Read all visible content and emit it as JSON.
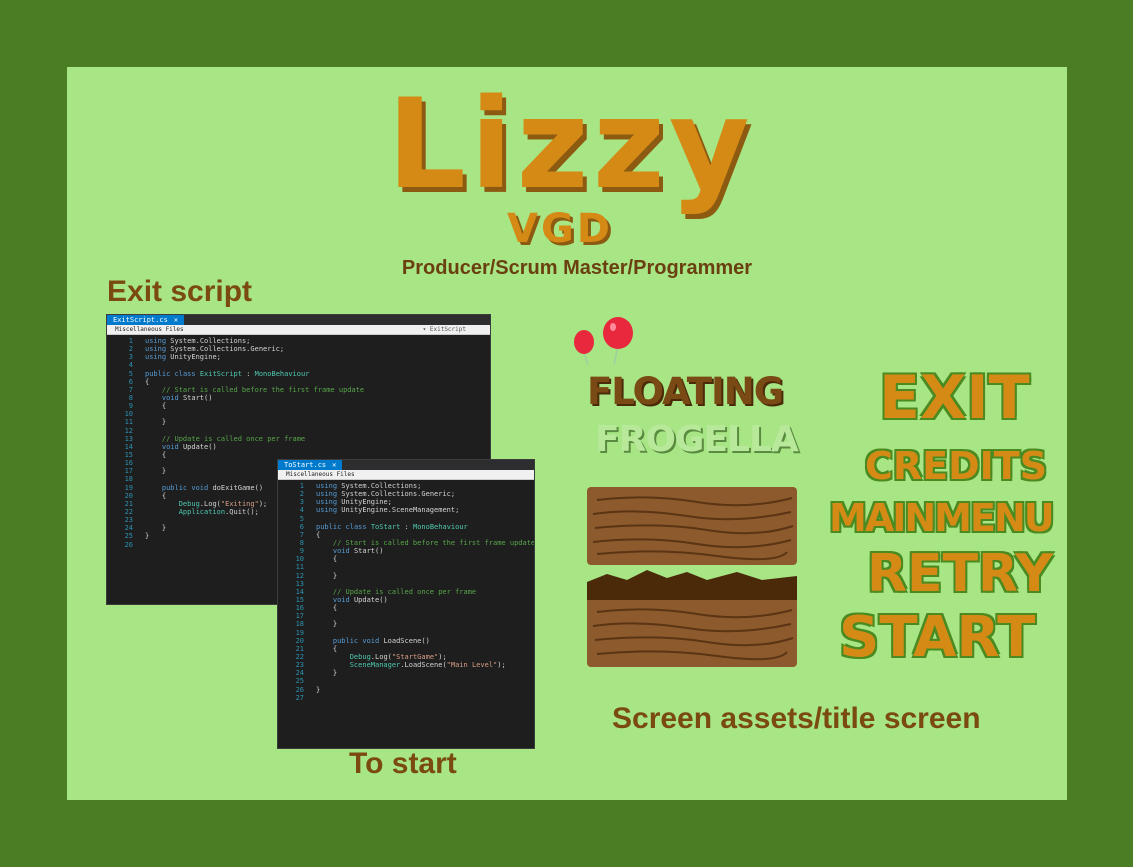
{
  "header": {
    "title": "Lizzy",
    "subtitle": "VGD",
    "role": "Producer/Scrum Master/Programmer"
  },
  "sections": {
    "exit_label": "Exit script",
    "start_label": "To start",
    "assets_label": "Screen assets/title screen"
  },
  "exit_window": {
    "tab": "ExitScript.cs",
    "breadcrumb": "Miscellaneous Files",
    "member": "ExitScript",
    "lines": [
      {
        "n": "1",
        "text": "using System.Collections;"
      },
      {
        "n": "2",
        "text": "using System.Collections.Generic;"
      },
      {
        "n": "3",
        "text": "using UnityEngine;"
      },
      {
        "n": "4",
        "text": ""
      },
      {
        "n": "5",
        "text": "public class ExitScript : MonoBehaviour"
      },
      {
        "n": "6",
        "text": "{"
      },
      {
        "n": "7",
        "text": "    // Start is called before the first frame update"
      },
      {
        "n": "8",
        "text": "    void Start()"
      },
      {
        "n": "9",
        "text": "    {"
      },
      {
        "n": "10",
        "text": ""
      },
      {
        "n": "11",
        "text": "    }"
      },
      {
        "n": "12",
        "text": ""
      },
      {
        "n": "13",
        "text": "    // Update is called once per frame"
      },
      {
        "n": "14",
        "text": "    void Update()"
      },
      {
        "n": "15",
        "text": "    {"
      },
      {
        "n": "16",
        "text": ""
      },
      {
        "n": "17",
        "text": "    }"
      },
      {
        "n": "18",
        "text": ""
      },
      {
        "n": "19",
        "text": "    public void doExitGame()"
      },
      {
        "n": "20",
        "text": "    {"
      },
      {
        "n": "21",
        "text": "        Debug.Log(\"Exiting\");"
      },
      {
        "n": "22",
        "text": "        Application.Quit();"
      },
      {
        "n": "23",
        "text": ""
      },
      {
        "n": "24",
        "text": "    }"
      },
      {
        "n": "25",
        "text": "}"
      },
      {
        "n": "26",
        "text": ""
      }
    ]
  },
  "start_window": {
    "tab": "ToStart.cs",
    "breadcrumb": "Miscellaneous Files",
    "lines": [
      {
        "n": "1",
        "text": "using System.Collections;"
      },
      {
        "n": "2",
        "text": "using System.Collections.Generic;"
      },
      {
        "n": "3",
        "text": "using UnityEngine;"
      },
      {
        "n": "4",
        "text": "using UnityEngine.SceneManagement;"
      },
      {
        "n": "5",
        "text": ""
      },
      {
        "n": "6",
        "text": "public class ToStart : MonoBehaviour"
      },
      {
        "n": "7",
        "text": "{"
      },
      {
        "n": "8",
        "text": "    // Start is called before the first frame update"
      },
      {
        "n": "9",
        "text": "    void Start()"
      },
      {
        "n": "10",
        "text": "    {"
      },
      {
        "n": "11",
        "text": ""
      },
      {
        "n": "12",
        "text": "    }"
      },
      {
        "n": "13",
        "text": ""
      },
      {
        "n": "14",
        "text": "    // Update is called once per frame"
      },
      {
        "n": "15",
        "text": "    void Update()"
      },
      {
        "n": "16",
        "text": "    {"
      },
      {
        "n": "17",
        "text": ""
      },
      {
        "n": "18",
        "text": "    }"
      },
      {
        "n": "19",
        "text": ""
      },
      {
        "n": "20",
        "text": "    public void LoadScene()"
      },
      {
        "n": "21",
        "text": "    {"
      },
      {
        "n": "22",
        "text": "        Debug.Log(\"StartGame\");"
      },
      {
        "n": "23",
        "text": "        SceneManager.LoadScene(\"Main Level\");"
      },
      {
        "n": "24",
        "text": "    }"
      },
      {
        "n": "25",
        "text": ""
      },
      {
        "n": "26",
        "text": "}"
      },
      {
        "n": "27",
        "text": ""
      }
    ]
  },
  "game_title": {
    "line1": "FLOATING",
    "line2": "FROGELLA"
  },
  "menu": {
    "exit": "EXIT",
    "credits": "CREDITS",
    "main_menu": "MAINMENU",
    "retry": "RETRY",
    "start": "START"
  },
  "colors": {
    "frame": "#4a7d24",
    "panel": "#a7e585",
    "title_orange": "#d48a14",
    "label_brown": "#7a4a10",
    "code_bg": "#1e1e1e"
  }
}
